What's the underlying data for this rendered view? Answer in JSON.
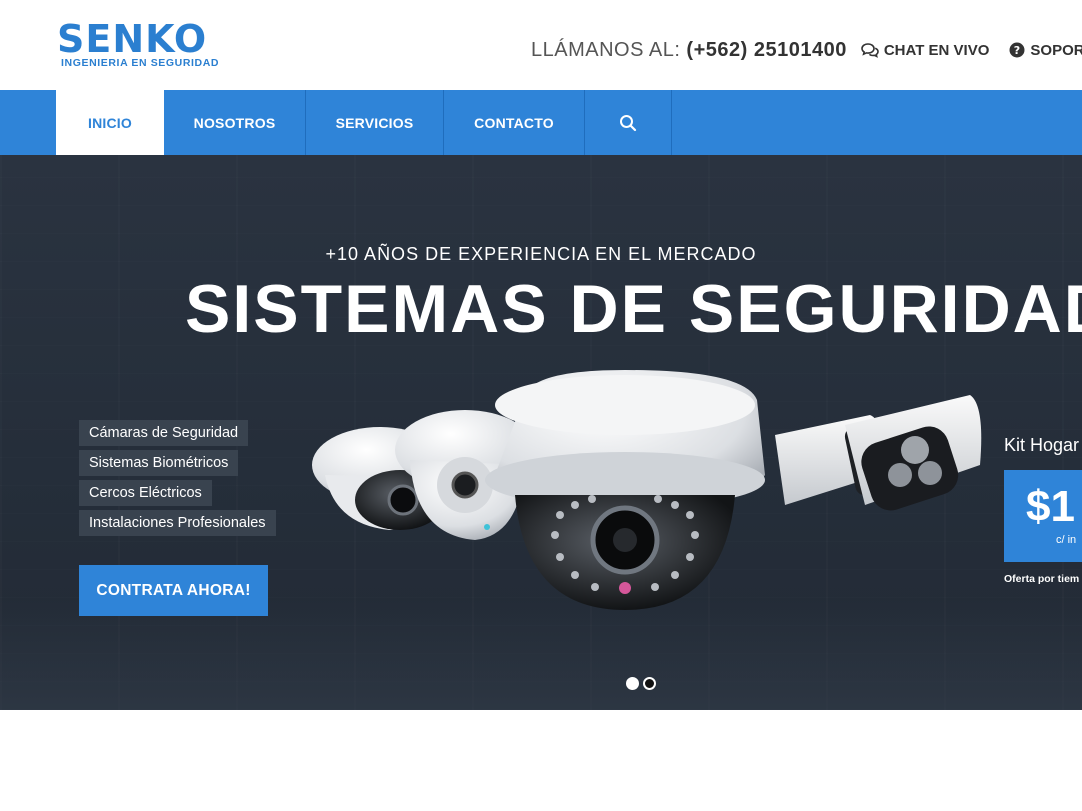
{
  "header": {
    "logo_main": "SENKO",
    "logo_sub": "INGENIERIA EN SEGURIDAD",
    "call_label": "LLÁMANOS AL:",
    "call_number": "(+562) 25101400",
    "chat_label": "CHAT EN VIVO",
    "chat_icon": "chat-bubbles-icon",
    "support_label": "SOPORTE",
    "support_icon": "question-circle-icon"
  },
  "nav": {
    "items": [
      {
        "label": "INICIO",
        "active": true
      },
      {
        "label": "NOSOTROS",
        "active": false
      },
      {
        "label": "SERVICIOS",
        "active": false
      },
      {
        "label": "CONTACTO",
        "active": false
      }
    ],
    "search_icon": "search-icon"
  },
  "hero": {
    "subtitle": "+10 AÑOS DE EXPERIENCIA EN EL MERCADO",
    "title": "SISTEMAS DE SEGURIDAD",
    "features": [
      "Cámaras de Seguridad",
      "Sistemas Biométricos",
      "Cercos Eléctricos",
      "Instalaciones Profesionales"
    ],
    "cta_label": "CONTRATA AHORA!",
    "kit_title": "Kit Hogar",
    "price": "$1",
    "price_note": "c/ in",
    "offer": "Oferta por tiem",
    "slides": {
      "count": 2,
      "active": 1
    }
  },
  "colors": {
    "brand_blue": "#2f84d8",
    "hero_bg": "#252e3a",
    "feature_bg": "#39434f"
  }
}
